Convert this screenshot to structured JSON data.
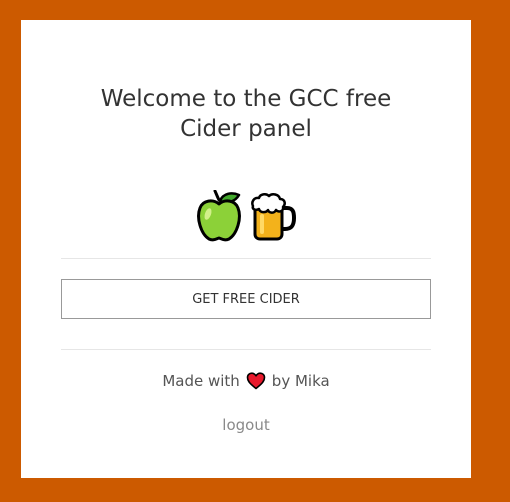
{
  "page": {
    "title_line1": "Welcome to the GCC free",
    "title_line2": "Cider panel"
  },
  "icons": [
    "green-apple-icon",
    "beer-mug-icon",
    "heart-icon"
  ],
  "actions": {
    "get_cider_label": "GET FREE CIDER",
    "logout_label": "logout"
  },
  "footer": {
    "made_with_prefix": "Made with",
    "made_with_suffix": "by Mika"
  },
  "colors": {
    "background": "#cc5a00",
    "card": "#ffffff",
    "heart": "#e8192c"
  }
}
